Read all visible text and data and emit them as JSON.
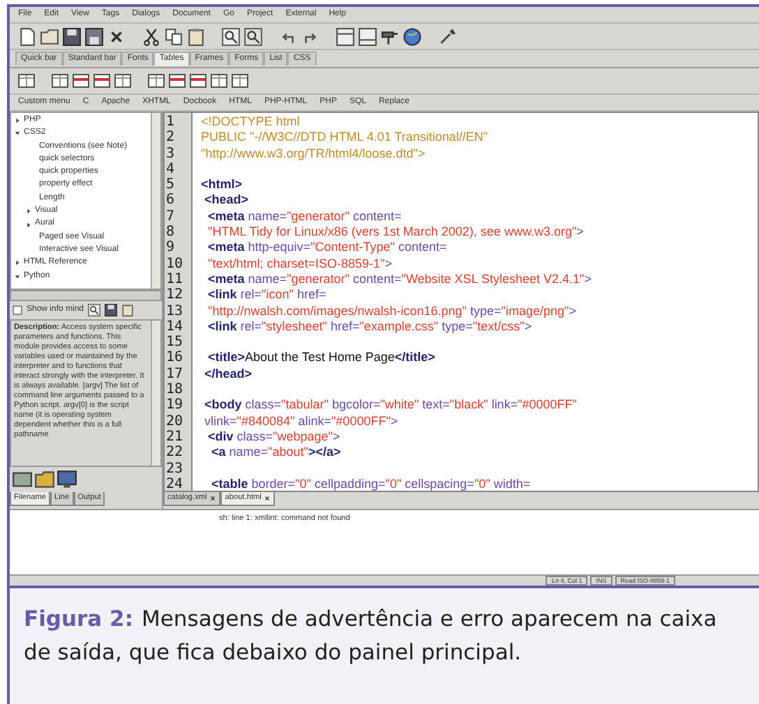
{
  "menu": [
    "File",
    "Edit",
    "View",
    "Tags",
    "Dialogs",
    "Document",
    "Go",
    "Project",
    "External",
    "Help"
  ],
  "toolbar_tabs": [
    {
      "label": "Quick bar",
      "selected": false
    },
    {
      "label": "Standard bar",
      "selected": false
    },
    {
      "label": "Fonts",
      "selected": false
    },
    {
      "label": "Tables",
      "selected": true
    },
    {
      "label": "Frames",
      "selected": false
    },
    {
      "label": "Forms",
      "selected": false
    },
    {
      "label": "List",
      "selected": false
    },
    {
      "label": "CSS",
      "selected": false
    }
  ],
  "custom_menu": [
    "Custom menu",
    "C",
    "Apache",
    "XHTML",
    "Docbook",
    "HTML",
    "PHP-HTML",
    "PHP",
    "SQL",
    "Replace"
  ],
  "tree": [
    {
      "label": "PHP",
      "expanded": false
    },
    {
      "label": "CSS2",
      "expanded": true,
      "children": [
        {
          "label": "Conventions (see Note)"
        },
        {
          "label": "quick selectors"
        },
        {
          "label": "quick properties"
        },
        {
          "label": "property effect"
        },
        {
          "label": "Length"
        },
        {
          "label": "Visual",
          "expanded": false
        },
        {
          "label": "Aural",
          "expanded": false
        },
        {
          "label": "Paged see Visual"
        },
        {
          "label": "Interactive see Visual"
        }
      ]
    },
    {
      "label": "HTML Reference",
      "expanded": false
    },
    {
      "label": "Python",
      "expanded": true
    }
  ],
  "info_toggle": {
    "label": "Show info mind"
  },
  "description": "**Description:** Access system specific parameters and functions. This module provides access to some variables used or maintained by the interpreter and to functions that interact strongly with the interpreter. It is always available. [argv] The list of command line arguments passed to a Python script. argv[0] is the script name (it is operating system dependent whether this is a full pathname",
  "left_tabs": [
    {
      "label": "Filename",
      "selected": true
    },
    {
      "label": "Line",
      "selected": false
    },
    {
      "label": "Output",
      "selected": false
    }
  ],
  "code": [
    {
      "n": "1",
      "tokens": [
        {
          "kind": "doctype",
          "text": "<!DOCTYPE html"
        }
      ]
    },
    {
      "n": "2",
      "tokens": [
        {
          "kind": "doctype",
          "text": "PUBLIC \"-//W3C//DTD HTML 4.01 Transitional//EN\""
        }
      ]
    },
    {
      "n": "3",
      "tokens": [
        {
          "kind": "doctype",
          "text": "\"http://www.w3.org/TR/html4/loose.dtd\">"
        }
      ]
    },
    {
      "n": "4"
    },
    {
      "n": "5",
      "tokens": [
        {
          "kind": "tag",
          "text": "<html>"
        }
      ]
    },
    {
      "n": "6",
      "tokens": [
        {
          "kind": "tag",
          "text": " <head>"
        }
      ]
    },
    {
      "n": "7",
      "tokens": [
        {
          "kind": "tag",
          "text": "  <meta"
        },
        {
          "kind": "attr",
          "text": " name="
        },
        {
          "kind": "value",
          "text": "\"generator\""
        },
        {
          "kind": "attr",
          "text": " content="
        }
      ]
    },
    {
      "n": "8",
      "tokens": [
        {
          "kind": "value",
          "text": "  \"HTML Tidy for Linux/x86 (vers 1st March 2002), see www.w3.org\""
        },
        {
          "kind": "attr",
          "text": ">"
        }
      ]
    },
    {
      "n": "9",
      "tokens": [
        {
          "kind": "tag",
          "text": "  <meta"
        },
        {
          "kind": "attr",
          "text": " http-equiv="
        },
        {
          "kind": "value",
          "text": "\"Content-Type\""
        },
        {
          "kind": "attr",
          "text": " content="
        }
      ]
    },
    {
      "n": "10",
      "tokens": [
        {
          "kind": "value",
          "text": "  \"text/html; charset=ISO-8859-1\""
        },
        {
          "kind": "attr",
          "text": ">"
        }
      ]
    },
    {
      "n": "11",
      "tokens": [
        {
          "kind": "tag",
          "text": "  <meta"
        },
        {
          "kind": "attr",
          "text": " name="
        },
        {
          "kind": "value",
          "text": "\"generator\""
        },
        {
          "kind": "attr",
          "text": " content="
        },
        {
          "kind": "value",
          "text": "\"Website XSL Stylesheet V2.4.1\""
        },
        {
          "kind": "attr",
          "text": ">"
        }
      ]
    },
    {
      "n": "12",
      "tokens": [
        {
          "kind": "tag",
          "text": "  <link"
        },
        {
          "kind": "attr",
          "text": " rel="
        },
        {
          "kind": "value",
          "text": "\"icon\""
        },
        {
          "kind": "attr",
          "text": " href="
        }
      ]
    },
    {
      "n": "13",
      "tokens": [
        {
          "kind": "value",
          "text": "  \"http://nwalsh.com/images/nwalsh-icon16.png\""
        },
        {
          "kind": "attr",
          "text": " type="
        },
        {
          "kind": "value",
          "text": "\"image/png\""
        },
        {
          "kind": "attr",
          "text": ">"
        }
      ]
    },
    {
      "n": "14",
      "tokens": [
        {
          "kind": "tag",
          "text": "  <link"
        },
        {
          "kind": "attr",
          "text": " rel="
        },
        {
          "kind": "value",
          "text": "\"stylesheet\""
        },
        {
          "kind": "attr",
          "text": " href="
        },
        {
          "kind": "value",
          "text": "\"example.css\""
        },
        {
          "kind": "attr",
          "text": " type="
        },
        {
          "kind": "value",
          "text": "\"text/css\""
        },
        {
          "kind": "attr",
          "text": ">"
        }
      ]
    },
    {
      "n": "15"
    },
    {
      "n": "16",
      "tokens": [
        {
          "kind": "tag",
          "text": "  <title>"
        },
        {
          "kind": "text",
          "text": "About the Test Home Page"
        },
        {
          "kind": "tag",
          "text": "</title>"
        }
      ]
    },
    {
      "n": "17",
      "tokens": [
        {
          "kind": "tag",
          "text": " </head>"
        }
      ]
    },
    {
      "n": "18"
    },
    {
      "n": "19",
      "tokens": [
        {
          "kind": "tag",
          "text": " <body"
        },
        {
          "kind": "attr",
          "text": " class="
        },
        {
          "kind": "value",
          "text": "\"tabular\""
        },
        {
          "kind": "attr",
          "text": " bgcolor="
        },
        {
          "kind": "value",
          "text": "\"white\""
        },
        {
          "kind": "attr",
          "text": " text="
        },
        {
          "kind": "value",
          "text": "\"black\""
        },
        {
          "kind": "attr",
          "text": " link="
        },
        {
          "kind": "value",
          "text": "\"#0000FF\""
        }
      ]
    },
    {
      "n": "20",
      "tokens": [
        {
          "kind": "attr",
          "text": " vlink="
        },
        {
          "kind": "value",
          "text": "\"#840084\""
        },
        {
          "kind": "attr",
          "text": " alink="
        },
        {
          "kind": "value",
          "text": "\"#0000FF\""
        },
        {
          "kind": "attr",
          "text": ">"
        }
      ]
    },
    {
      "n": "21",
      "tokens": [
        {
          "kind": "tag",
          "text": "  <div"
        },
        {
          "kind": "attr",
          "text": " class="
        },
        {
          "kind": "value",
          "text": "\"webpage\""
        },
        {
          "kind": "attr",
          "text": ">"
        }
      ]
    },
    {
      "n": "22",
      "tokens": [
        {
          "kind": "tag",
          "text": "   <a"
        },
        {
          "kind": "attr",
          "text": " name="
        },
        {
          "kind": "value",
          "text": "\"about\""
        },
        {
          "kind": "tag",
          "text": "></a>"
        }
      ]
    },
    {
      "n": "23"
    },
    {
      "n": "24",
      "tokens": [
        {
          "kind": "tag",
          "text": "   <table"
        },
        {
          "kind": "attr",
          "text": " border="
        },
        {
          "kind": "value",
          "text": "\"0\""
        },
        {
          "kind": "attr",
          "text": " cellpadding="
        },
        {
          "kind": "value",
          "text": "\"0\""
        },
        {
          "kind": "attr",
          "text": " cellspacing="
        },
        {
          "kind": "value",
          "text": "\"0\""
        },
        {
          "kind": "attr",
          "text": " width="
        }
      ]
    }
  ],
  "editor_tabs": [
    {
      "label": "catalog.xml",
      "selected": false
    },
    {
      "label": "about.html",
      "selected": true
    }
  ],
  "output": "sh: line 1: xmllint: command not found",
  "status_bar": [
    "Ln 4, Col 1",
    "INS",
    "Read ISO-8859-1"
  ],
  "caption": {
    "label": "Figura 2:",
    "text": "Mensagens de advertência e erro aparecem na caixa de saída, que fica debaixo do painel principal."
  }
}
